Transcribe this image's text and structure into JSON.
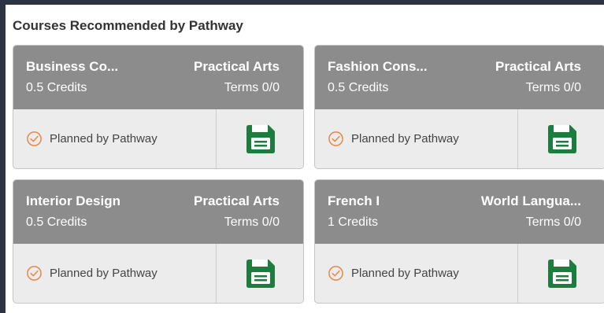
{
  "section": {
    "title": "Courses Recommended by Pathway"
  },
  "colors": {
    "header_gray": "#8c8c8c",
    "check_orange": "#e8894a",
    "save_green": "#1c7d3e"
  },
  "courses": [
    {
      "name": "Business Co...",
      "category": "Practical Arts",
      "credits": "0.5 Credits",
      "terms": "Terms 0/0",
      "status": "Planned by Pathway",
      "status_icon": "check-circle-icon",
      "action_icon": "save-icon"
    },
    {
      "name": "Fashion Cons...",
      "category": "Practical Arts",
      "credits": "0.5 Credits",
      "terms": "Terms 0/0",
      "status": "Planned by Pathway",
      "status_icon": "check-circle-icon",
      "action_icon": "save-icon"
    },
    {
      "name": "Interior Design",
      "category": "Practical Arts",
      "credits": "0.5 Credits",
      "terms": "Terms 0/0",
      "status": "Planned by Pathway",
      "status_icon": "check-circle-icon",
      "action_icon": "save-icon"
    },
    {
      "name": "French I",
      "category": "World Langua...",
      "credits": "1 Credits",
      "terms": "Terms 0/0",
      "status": "Planned by Pathway",
      "status_icon": "check-circle-icon",
      "action_icon": "save-icon"
    }
  ]
}
